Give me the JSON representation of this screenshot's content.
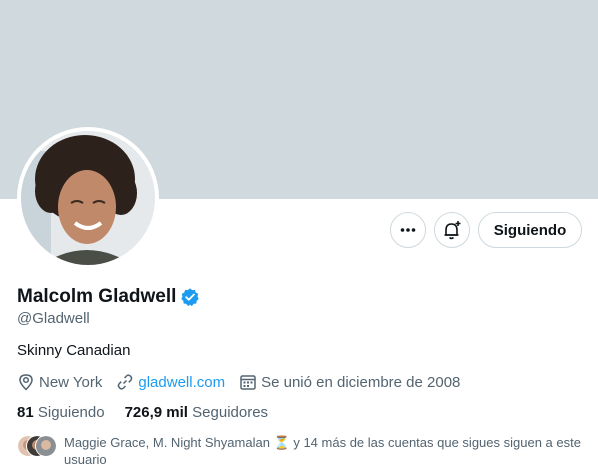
{
  "profile": {
    "name": "Malcolm Gladwell",
    "handle": "@Gladwell",
    "bio": "Skinny Canadian",
    "location": "New York",
    "website": "gladwell.com",
    "joined": "Se unió en diciembre de 2008"
  },
  "actions": {
    "more_label": "•••",
    "follow_label": "Siguiendo"
  },
  "stats": {
    "following_count": "81",
    "following_label": "Siguiendo",
    "followers_count": "726,9 mil",
    "followers_label": "Seguidores"
  },
  "known_followers": {
    "text": "Maggie Grace, M. Night Shyamalan ⏳ y 14 más de las cuentas que sigues siguen a este usuario"
  },
  "colors": {
    "banner": "#cfd9de",
    "accent": "#1d9bf0",
    "text_primary": "#0f1419",
    "text_secondary": "#536471"
  }
}
